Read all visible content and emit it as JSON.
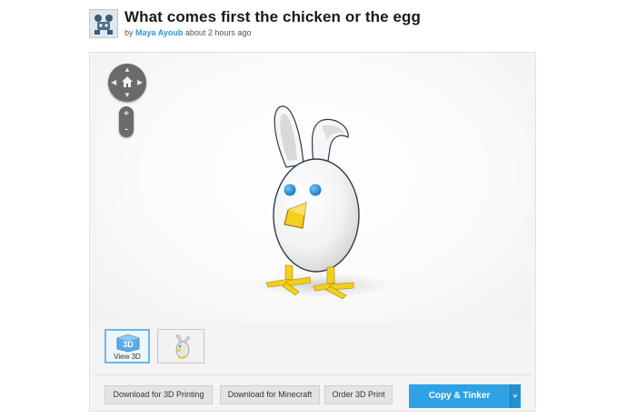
{
  "header": {
    "title": "What comes first the chicken or the egg",
    "byline_prefix": "by",
    "author": "Maya Ayoub",
    "time": "about 2 hours ago"
  },
  "viewer": {
    "zoom_in": "+",
    "zoom_out": "-",
    "nav_arrows": [
      "up",
      "down",
      "left",
      "right"
    ]
  },
  "thumbnails": {
    "view3d_badge": "3D",
    "view3d_label": "View 3D"
  },
  "actions": {
    "download_3d": "Download for 3D Printing",
    "download_minecraft": "Download for Minecraft",
    "order_print": "Order 3D Print",
    "copy_tinker": "Copy & Tinker"
  },
  "colors": {
    "accent": "#2ea2e4",
    "author_link": "#2a9ad8",
    "beak": "#f3cf1e",
    "eyes": "#1e8fd8"
  }
}
